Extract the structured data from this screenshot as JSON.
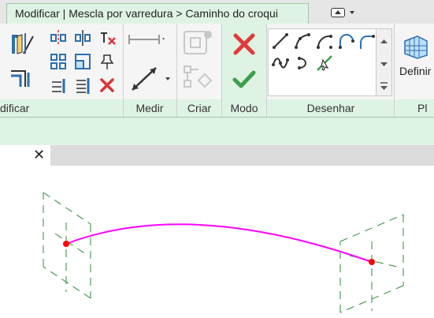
{
  "context_tab": {
    "label": "Modificar | Mescla por varredura > Caminho do croqui"
  },
  "quick_access": {
    "icons": [
      "toggle-ribbon-icon",
      "dropdown-arrow-icon"
    ]
  },
  "ribbon": {
    "panels": [
      {
        "name": "modificar",
        "label": "dificar"
      },
      {
        "name": "medir",
        "label": "Medir"
      },
      {
        "name": "criar",
        "label": "Criar"
      },
      {
        "name": "modo",
        "label": "Modo"
      },
      {
        "name": "desenhar",
        "label": "Desenhar"
      },
      {
        "name": "plano",
        "label": "Pl"
      }
    ],
    "definir_label": "Definir"
  },
  "colors": {
    "context_green": "#dff3e4",
    "sweep_path": "#ff00ff",
    "endpoint": "#ff0000",
    "profile_lines": "#2e8b3c",
    "cancel_red": "#e03b3b",
    "finish_green": "#3aa04a"
  },
  "view": {
    "close_label": "✕"
  }
}
